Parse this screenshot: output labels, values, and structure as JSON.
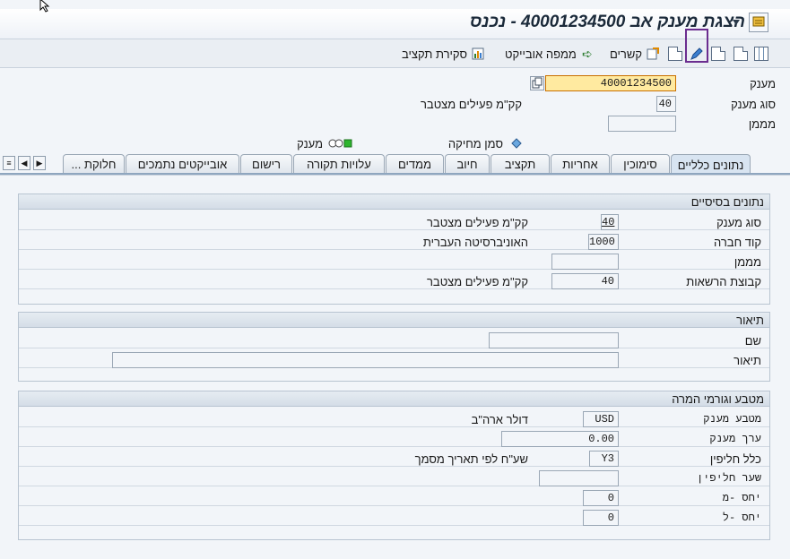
{
  "title": "הצגת מענק אב 40001234500 - נכנס",
  "toolbar": {
    "related": "קשרים",
    "object_map": "ממפה אובייקט",
    "budget_closing": "סקירת תקציב"
  },
  "header": {
    "grant_label": "מענק",
    "grant_value": "40001234500",
    "grant_type_label": "סוג מענק",
    "grant_type_value": "40",
    "grant_type_text": "קק\"מ פעילים מצטבר",
    "sponsor_label": "מממן",
    "sponsor_value": "",
    "legend_flag": "סמן מחיקה",
    "legend_grant": "מענק"
  },
  "tabs": [
    "נתונים כלליים",
    "סימוכין",
    "אחריות",
    "תקציב",
    "חיוב",
    "ממדים",
    "עלויות תקורה",
    "רישום",
    "אובייקטים נתמכים",
    "חלוקת ..."
  ],
  "basic": {
    "heading": "נתונים בסיסיים",
    "grant_type_label": "סוג מענק",
    "grant_type_value": "40",
    "grant_type_text": "קק\"מ פעילים מצטבר",
    "company_label": "קוד חברה",
    "company_value": "1000",
    "company_text": "האוניברסיטה העברית",
    "sponsor_label": "מממן",
    "sponsor_value": "",
    "auth_group_label": "קבוצת הרשאות",
    "auth_group_value": "40",
    "auth_group_text": "קק\"מ פעילים מצטבר"
  },
  "desc": {
    "heading": "תיאור",
    "name_label": "שם",
    "name_value": "",
    "desc_label": "תיאור",
    "desc_value": ""
  },
  "currency": {
    "heading": "מטבע וגורמי המרה",
    "currency_label": "מטבע מענק",
    "currency_value": "USD",
    "currency_text": "דולר ארה\"ב",
    "value_label": "ערך מענק",
    "value_value": "0.00",
    "rule_label": "כלל חליפין",
    "rule_value": "Y3",
    "rule_text": "שע\"ח לפי תאריך מסמך",
    "rate_label": "שער חליפין",
    "rate_value": "",
    "ratio_from_label": "יחס -מ",
    "ratio_from_value": "0",
    "ratio_to_label": "יחס -ל",
    "ratio_to_value": "0"
  }
}
